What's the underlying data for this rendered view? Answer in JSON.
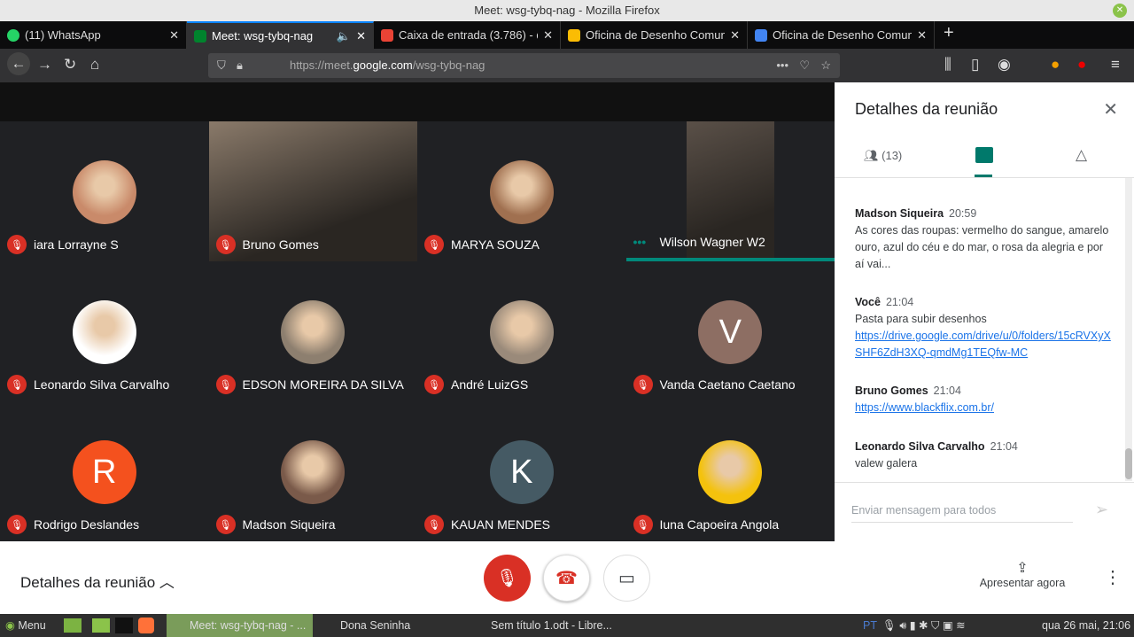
{
  "window": {
    "title": "Meet: wsg-tybq-nag - Mozilla Firefox"
  },
  "tabs": [
    {
      "label": "(11) WhatsApp",
      "color": "#25d366"
    },
    {
      "label": "Meet: wsg-tybq-nag",
      "color": "#00832d"
    },
    {
      "label": "Caixa de entrada (3.786) - d",
      "color": "#ea4335"
    },
    {
      "label": "Oficina de Desenho Comun",
      "color": "#fbbc04"
    },
    {
      "label": "Oficina de Desenho Comun",
      "color": "#4285f4"
    }
  ],
  "url": {
    "prefix": "https://meet.",
    "domain": "google.com",
    "path": "/wsg-tybq-nag"
  },
  "participants": [
    {
      "name": "iara Lorrayne S",
      "avatar": "photo",
      "color": "#c98a6a"
    },
    {
      "name": "Bruno Gomes",
      "avatar": "video",
      "color": "#8a7a6a"
    },
    {
      "name": "MARYA SOUZA",
      "avatar": "photo",
      "color": "#a07050"
    },
    {
      "name": "Wilson Wagner W2",
      "avatar": "video",
      "color": "#5a5048",
      "speaking": true
    },
    {
      "name": "Leonardo Silva Carvalho",
      "avatar": "photo",
      "color": "#ffffff"
    },
    {
      "name": "EDSON MOREIRA DA SILVA",
      "avatar": "photo",
      "color": "#8d7f6f"
    },
    {
      "name": "André LuizGS",
      "avatar": "photo",
      "color": "#9a8a7a"
    },
    {
      "name": "Vanda Caetano Caetano",
      "avatar": "V",
      "color": "#8d6e63"
    },
    {
      "name": "Rodrigo Deslandes",
      "avatar": "R",
      "color": "#f4511e"
    },
    {
      "name": "Madson Siqueira",
      "avatar": "photo",
      "color": "#7a5a4a"
    },
    {
      "name": "KAUAN MENDES",
      "avatar": "K",
      "color": "#455a64"
    },
    {
      "name": "Iuna Capoeira Angola",
      "avatar": "photo",
      "color": "#f4c20d"
    }
  ],
  "panel": {
    "title": "Detalhes da reunião",
    "people_count": "(13)",
    "messages": [
      {
        "sender": "Madson Siqueira",
        "time": "20:59",
        "text": "As cores das roupas: vermelho do sangue, amarelo ouro, azul do céu e do mar, o rosa da alegria e por aí vai..."
      },
      {
        "sender": "Você",
        "time": "21:04",
        "text": "Pasta para subir desenhos",
        "link": "https://drive.google.com/drive/u/0/folders/15cRVXyXSHF6ZdH3XQ-qmdMg1TEQfw-MC"
      },
      {
        "sender": "Bruno Gomes",
        "time": "21:04",
        "link": "https://www.blackflix.com.br/"
      },
      {
        "sender": "Leonardo Silva Carvalho",
        "time": "21:04",
        "text": "valew galera"
      }
    ],
    "input_placeholder": "Enviar mensagem para todos"
  },
  "bottom": {
    "details_label": "Detalhes da reunião",
    "present_label": "Apresentar agora"
  },
  "taskbar": {
    "menu": "Menu",
    "items": [
      "Meet: wsg-tybq-nag - ...",
      "Dona Seninha",
      "Sem título 1.odt - Libre..."
    ],
    "lang": "PT",
    "clock": "qua 26 mai, 21:06"
  },
  "colors": {
    "accent": "#00897b",
    "mute_red": "#d93025"
  }
}
